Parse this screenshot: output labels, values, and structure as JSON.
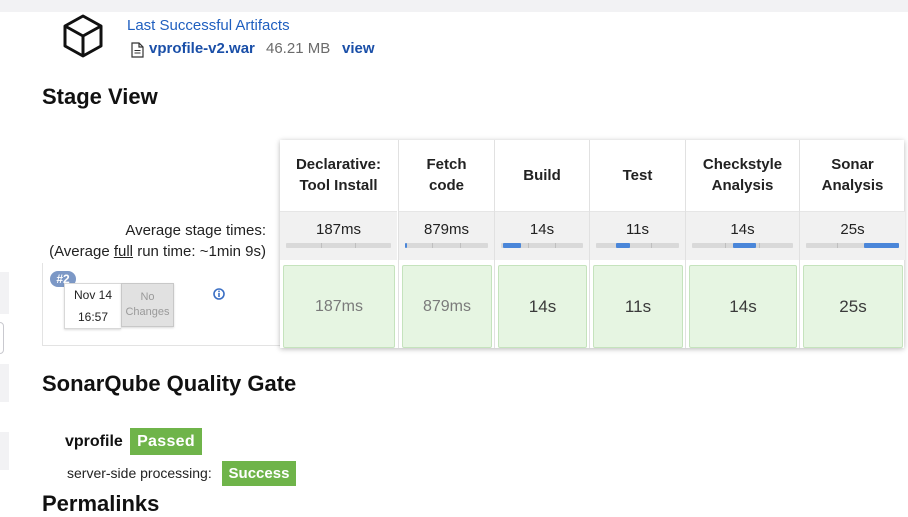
{
  "artifacts": {
    "title": "Last Successful Artifacts",
    "file_name": "vprofile-v2.war",
    "file_size": "46.21 MB",
    "view_label": "view",
    "icon": "box-icon",
    "file_icon": "file-icon"
  },
  "stage_view": {
    "title": "Stage View",
    "avg_label_line1": "Average stage times:",
    "avg_label_pre": "(Average ",
    "avg_label_full": "full",
    "avg_label_post": " run time: ~1min 9s)",
    "stages": [
      {
        "name_line1": "Declarative:",
        "name_line2": "Tool Install",
        "avg": "187ms",
        "cell": "187ms",
        "bar_fraction": 0.0
      },
      {
        "name_line1": "Fetch",
        "name_line2": "code",
        "avg": "879ms",
        "cell": "879ms",
        "bar_fraction": 0.02
      },
      {
        "name_line1": "Build",
        "name_line2": "",
        "avg": "14s",
        "cell": "14s",
        "bar_fraction": 0.22
      },
      {
        "name_line1": "Test",
        "name_line2": "",
        "avg": "11s",
        "cell": "11s",
        "bar_fraction": 0.17
      },
      {
        "name_line1": "Checkstyle",
        "name_line2": "Analysis",
        "avg": "14s",
        "cell": "14s",
        "bar_fraction": 0.22
      },
      {
        "name_line1": "Sonar",
        "name_line2": "Analysis",
        "avg": "25s",
        "cell": "25s",
        "bar_fraction": 0.38
      }
    ],
    "run": {
      "badge": "#2",
      "date": "Nov 14",
      "time": "16:57",
      "changes_line1": "No",
      "changes_line2": "Changes",
      "info_icon": "info-icon"
    },
    "colors": {
      "bar_fill": "#4a86d9",
      "cell_success": "#e6f5e2"
    }
  },
  "quality_gate": {
    "title": "SonarQube Quality Gate",
    "project": "vprofile",
    "status": "Passed",
    "processing_label": "server-side processing:",
    "processing_status": "Success",
    "status_color": "#6fb44a"
  },
  "permalinks": {
    "title": "Permalinks"
  }
}
